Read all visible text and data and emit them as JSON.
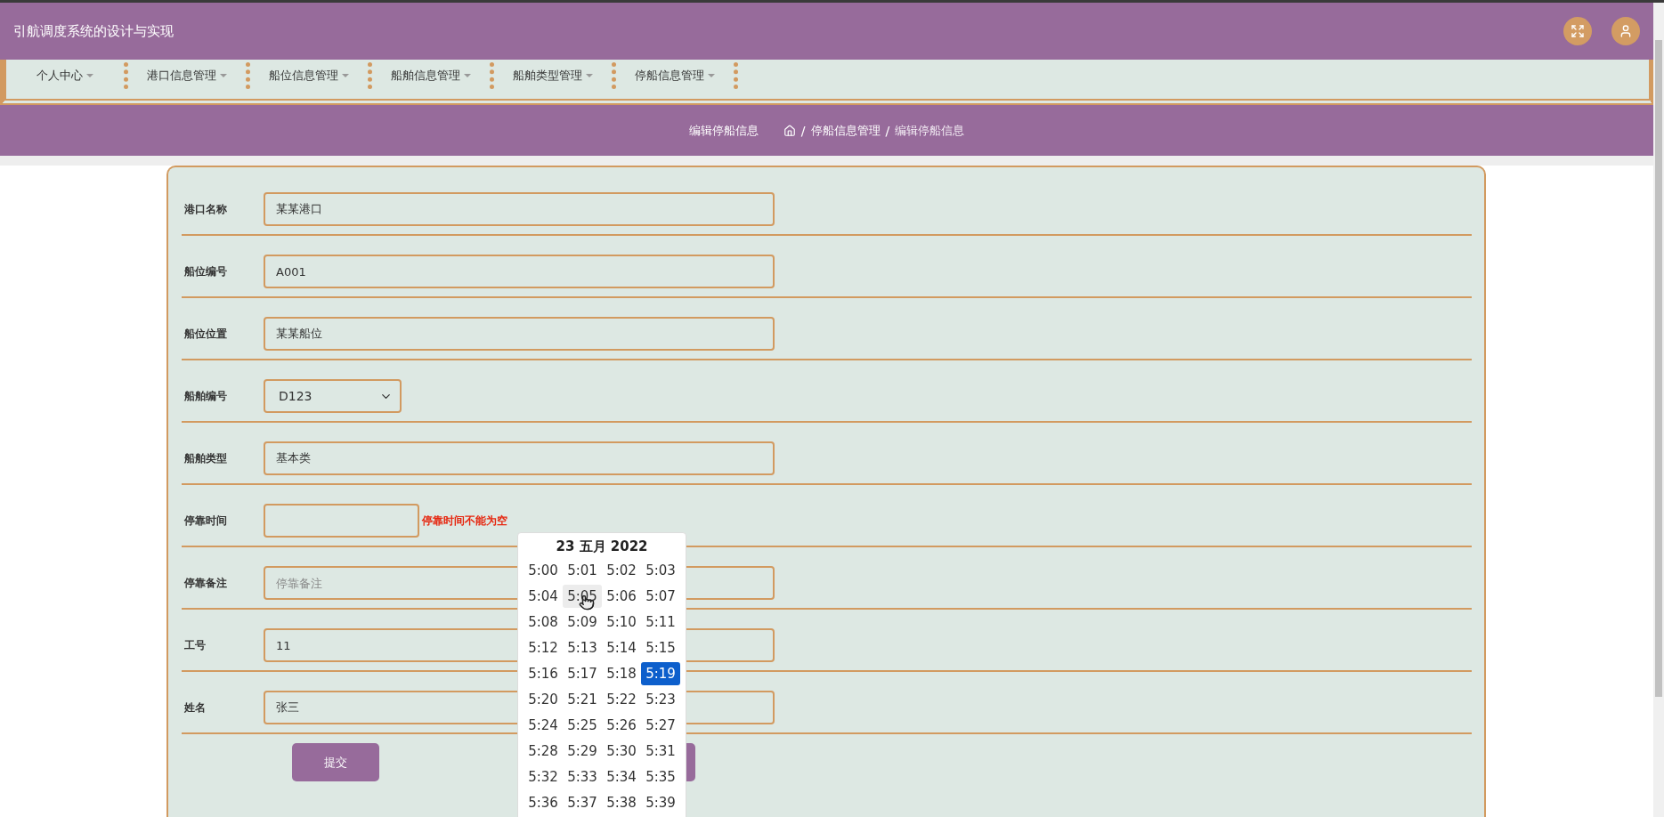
{
  "header": {
    "title": "引航调度系统的设计与实现"
  },
  "nav": [
    {
      "label": "个人中心"
    },
    {
      "label": "港口信息管理"
    },
    {
      "label": "船位信息管理"
    },
    {
      "label": "船舶信息管理"
    },
    {
      "label": "船舶类型管理"
    },
    {
      "label": "停船信息管理"
    }
  ],
  "page_bar": {
    "title": "编辑停船信息",
    "breadcrumb": [
      {
        "kind": "separator",
        "text": "/"
      },
      {
        "kind": "link",
        "text": "停船信息管理"
      },
      {
        "kind": "separator",
        "text": "/"
      },
      {
        "kind": "current",
        "text": "编辑停船信息"
      }
    ]
  },
  "form": {
    "fields": [
      {
        "label": "港口名称",
        "kind": "text",
        "value": "某某港口"
      },
      {
        "label": "船位编号",
        "kind": "text",
        "value": "A001"
      },
      {
        "label": "船位位置",
        "kind": "text",
        "value": "某某船位"
      },
      {
        "label": "船舶编号",
        "kind": "select",
        "value": "D123"
      },
      {
        "label": "船舶类型",
        "kind": "text",
        "value": "基本类"
      },
      {
        "label": "停靠时间",
        "kind": "time",
        "error": "停靠时间不能为空"
      },
      {
        "label": "停靠备注",
        "kind": "text",
        "placeholder": "停靠备注"
      },
      {
        "label": "工号",
        "kind": "text",
        "value": "11"
      },
      {
        "label": "姓名",
        "kind": "text",
        "value": "张三"
      }
    ],
    "buttons": [
      {
        "label": "提交"
      }
    ],
    "covered_button": true
  },
  "datepicker": {
    "date": "23 五月 2022",
    "times": [
      {
        "label": "5:00",
        "selected": false,
        "hovered": false
      },
      {
        "label": "5:01",
        "selected": false,
        "hovered": false
      },
      {
        "label": "5:02",
        "selected": false,
        "hovered": false
      },
      {
        "label": "5:03",
        "selected": false,
        "hovered": false
      },
      {
        "label": "5:04",
        "selected": false,
        "hovered": false
      },
      {
        "label": "5:05",
        "selected": false,
        "hovered": true
      },
      {
        "label": "5:06",
        "selected": false,
        "hovered": false
      },
      {
        "label": "5:07",
        "selected": false,
        "hovered": false
      },
      {
        "label": "5:08",
        "selected": false,
        "hovered": false
      },
      {
        "label": "5:09",
        "selected": false,
        "hovered": false
      },
      {
        "label": "5:10",
        "selected": false,
        "hovered": false
      },
      {
        "label": "5:11",
        "selected": false,
        "hovered": false
      },
      {
        "label": "5:12",
        "selected": false,
        "hovered": false
      },
      {
        "label": "5:13",
        "selected": false,
        "hovered": false
      },
      {
        "label": "5:14",
        "selected": false,
        "hovered": false
      },
      {
        "label": "5:15",
        "selected": false,
        "hovered": false
      },
      {
        "label": "5:16",
        "selected": false,
        "hovered": false
      },
      {
        "label": "5:17",
        "selected": false,
        "hovered": false
      },
      {
        "label": "5:18",
        "selected": false,
        "hovered": false
      },
      {
        "label": "5:19",
        "selected": true,
        "hovered": false
      },
      {
        "label": "5:20",
        "selected": false,
        "hovered": false
      },
      {
        "label": "5:21",
        "selected": false,
        "hovered": false
      },
      {
        "label": "5:22",
        "selected": false,
        "hovered": false
      },
      {
        "label": "5:23",
        "selected": false,
        "hovered": false
      },
      {
        "label": "5:24",
        "selected": false,
        "hovered": false
      },
      {
        "label": "5:25",
        "selected": false,
        "hovered": false
      },
      {
        "label": "5:26",
        "selected": false,
        "hovered": false
      },
      {
        "label": "5:27",
        "selected": false,
        "hovered": false
      },
      {
        "label": "5:28",
        "selected": false,
        "hovered": false
      },
      {
        "label": "5:29",
        "selected": false,
        "hovered": false
      },
      {
        "label": "5:30",
        "selected": false,
        "hovered": false
      },
      {
        "label": "5:31",
        "selected": false,
        "hovered": false
      },
      {
        "label": "5:32",
        "selected": false,
        "hovered": false
      },
      {
        "label": "5:33",
        "selected": false,
        "hovered": false
      },
      {
        "label": "5:34",
        "selected": false,
        "hovered": false
      },
      {
        "label": "5:35",
        "selected": false,
        "hovered": false
      },
      {
        "label": "5:36",
        "selected": false,
        "hovered": false
      },
      {
        "label": "5:37",
        "selected": false,
        "hovered": false
      },
      {
        "label": "5:38",
        "selected": false,
        "hovered": false
      },
      {
        "label": "5:39",
        "selected": false,
        "hovered": false
      }
    ]
  }
}
